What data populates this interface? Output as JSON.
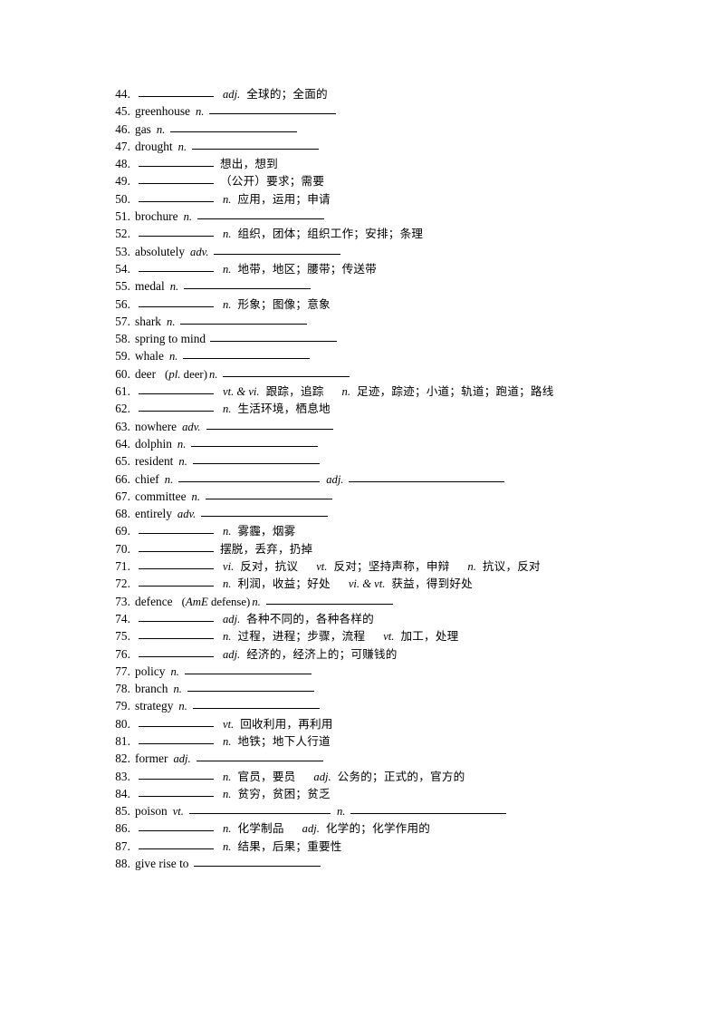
{
  "document": {
    "type": "vocabulary-worksheet",
    "first_number": 44,
    "last_number": 88
  },
  "entries": [
    {
      "num": "44.",
      "word": "",
      "blank_word": true,
      "parts": [
        {
          "pos": "adj.",
          "gloss": "全球的；全面的"
        }
      ]
    },
    {
      "num": "45.",
      "word": "greenhouse",
      "blank_word": false,
      "parts": [
        {
          "pos": "n.",
          "gloss": "",
          "blank": "def-slot"
        }
      ]
    },
    {
      "num": "46.",
      "word": "gas",
      "blank_word": false,
      "parts": [
        {
          "pos": "n.",
          "gloss": "",
          "blank": "def-slot"
        }
      ]
    },
    {
      "num": "47.",
      "word": "drought",
      "blank_word": false,
      "parts": [
        {
          "pos": "n.",
          "gloss": "",
          "blank": "def-slot"
        }
      ]
    },
    {
      "num": "48.",
      "word": "",
      "blank_word": true,
      "parts": [
        {
          "pos": "",
          "gloss": "想出，想到"
        }
      ]
    },
    {
      "num": "49.",
      "word": "",
      "blank_word": true,
      "parts": [
        {
          "pos": "",
          "gloss": "（公开）要求；需要"
        }
      ]
    },
    {
      "num": "50.",
      "word": "",
      "blank_word": true,
      "parts": [
        {
          "pos": "n.",
          "gloss": "应用，运用；申请"
        }
      ]
    },
    {
      "num": "51.",
      "word": "brochure",
      "blank_word": false,
      "parts": [
        {
          "pos": "n.",
          "gloss": "",
          "blank": "def-slot"
        }
      ]
    },
    {
      "num": "52.",
      "word": "",
      "blank_word": true,
      "parts": [
        {
          "pos": "n.",
          "gloss": "组织，团体；组织工作；安排；条理"
        }
      ]
    },
    {
      "num": "53.",
      "word": "absolutely",
      "blank_word": false,
      "parts": [
        {
          "pos": "adv.",
          "gloss": "",
          "blank": "def-slot"
        }
      ]
    },
    {
      "num": "54.",
      "word": "",
      "blank_word": true,
      "parts": [
        {
          "pos": "n.",
          "gloss": "地带，地区；腰带；传送带"
        }
      ]
    },
    {
      "num": "55.",
      "word": "medal",
      "blank_word": false,
      "parts": [
        {
          "pos": "n.",
          "gloss": "",
          "blank": "def-slot"
        }
      ]
    },
    {
      "num": "56.",
      "word": "",
      "blank_word": true,
      "parts": [
        {
          "pos": "n.",
          "gloss": "形象；图像；意象"
        }
      ]
    },
    {
      "num": "57.",
      "word": "shark",
      "blank_word": false,
      "parts": [
        {
          "pos": "n.",
          "gloss": "",
          "blank": "def-slot"
        }
      ]
    },
    {
      "num": "58.",
      "word": "spring to mind",
      "blank_word": false,
      "parts": [
        {
          "pos": "",
          "gloss": "",
          "blank": "def-slot"
        }
      ]
    },
    {
      "num": "59.",
      "word": "whale",
      "blank_word": false,
      "parts": [
        {
          "pos": "n.",
          "gloss": "",
          "blank": "def-slot"
        }
      ]
    },
    {
      "num": "60.",
      "word": "deer",
      "blank_word": false,
      "note": "(pl. deer)",
      "note_italic": "pl.",
      "note_rest": " deer)",
      "note_open": "(",
      "parts": [
        {
          "pos": "n.",
          "gloss": "",
          "blank": "def-slot",
          "after_note": true
        }
      ]
    },
    {
      "num": "61.",
      "word": "",
      "blank_word": true,
      "parts": [
        {
          "pos": "vt. & vi.",
          "gloss": "跟踪，追踪"
        },
        {
          "pos": "n.",
          "gloss": "足迹，踪迹；小道；轨道；跑道；路线"
        }
      ]
    },
    {
      "num": "62.",
      "word": "",
      "blank_word": true,
      "parts": [
        {
          "pos": "n.",
          "gloss": "生活环境，栖息地"
        }
      ]
    },
    {
      "num": "63.",
      "word": "nowhere",
      "blank_word": false,
      "parts": [
        {
          "pos": "adv.",
          "gloss": "",
          "blank": "def-slot"
        }
      ]
    },
    {
      "num": "64.",
      "word": "dolphin",
      "blank_word": false,
      "parts": [
        {
          "pos": "n.",
          "gloss": "",
          "blank": "def-slot"
        }
      ]
    },
    {
      "num": "65.",
      "word": "resident",
      "blank_word": false,
      "parts": [
        {
          "pos": "n.",
          "gloss": "",
          "blank": "def-slot"
        }
      ]
    },
    {
      "num": "66.",
      "word": "chief",
      "blank_word": false,
      "parts": [
        {
          "pos": "n.",
          "gloss": "",
          "blank": "def-wide"
        },
        {
          "pos": "adj.",
          "gloss": "",
          "blank": "def-xwide"
        }
      ]
    },
    {
      "num": "67.",
      "word": "committee",
      "blank_word": false,
      "parts": [
        {
          "pos": "n.",
          "gloss": "",
          "blank": "def-slot"
        }
      ]
    },
    {
      "num": "68.",
      "word": "entirely",
      "blank_word": false,
      "parts": [
        {
          "pos": "adv.",
          "gloss": "",
          "blank": "def-slot"
        }
      ]
    },
    {
      "num": "69.",
      "word": "",
      "blank_word": true,
      "parts": [
        {
          "pos": "n.",
          "gloss": "雾霾，烟雾"
        }
      ]
    },
    {
      "num": "70.",
      "word": "",
      "blank_word": true,
      "parts": [
        {
          "pos": "",
          "gloss": "摆脱，丢弃，扔掉"
        }
      ]
    },
    {
      "num": "71.",
      "word": "",
      "blank_word": true,
      "parts": [
        {
          "pos": "vi.",
          "gloss": "反对，抗议"
        },
        {
          "pos": "vt.",
          "gloss": "反对；坚持声称，申辩"
        },
        {
          "pos": "n.",
          "gloss": "抗议，反对"
        }
      ]
    },
    {
      "num": "72.",
      "word": "",
      "blank_word": true,
      "parts": [
        {
          "pos": "n.",
          "gloss": "利润，收益；好处"
        },
        {
          "pos": "vi. & vt.",
          "gloss": "获益，得到好处"
        }
      ]
    },
    {
      "num": "73.",
      "word": "defence",
      "blank_word": false,
      "note_open": "(",
      "note_italic": "AmE",
      "note_rest": " defense)",
      "parts": [
        {
          "pos": "n.",
          "gloss": "",
          "blank": "def-slot",
          "after_note": true
        }
      ]
    },
    {
      "num": "74.",
      "word": "",
      "blank_word": true,
      "parts": [
        {
          "pos": "adj.",
          "gloss": "各种不同的，各种各样的"
        }
      ]
    },
    {
      "num": "75.",
      "word": "",
      "blank_word": true,
      "parts": [
        {
          "pos": "n.",
          "gloss": "过程，进程；步骤，流程"
        },
        {
          "pos": "vt.",
          "gloss": "加工，处理"
        }
      ]
    },
    {
      "num": "76.",
      "word": "",
      "blank_word": true,
      "parts": [
        {
          "pos": "adj.",
          "gloss": "经济的，经济上的；可赚钱的"
        }
      ]
    },
    {
      "num": "77.",
      "word": "policy",
      "blank_word": false,
      "parts": [
        {
          "pos": "n.",
          "gloss": "",
          "blank": "def-slot"
        }
      ]
    },
    {
      "num": "78.",
      "word": "branch",
      "blank_word": false,
      "parts": [
        {
          "pos": "n.",
          "gloss": "",
          "blank": "def-slot"
        }
      ]
    },
    {
      "num": "79.",
      "word": "strategy",
      "blank_word": false,
      "parts": [
        {
          "pos": "n.",
          "gloss": "",
          "blank": "def-slot"
        }
      ]
    },
    {
      "num": "80.",
      "word": "",
      "blank_word": true,
      "parts": [
        {
          "pos": "vt.",
          "gloss": "回收利用，再利用"
        }
      ]
    },
    {
      "num": "81.",
      "word": "",
      "blank_word": true,
      "parts": [
        {
          "pos": "n.",
          "gloss": "地铁；地下人行道"
        }
      ]
    },
    {
      "num": "82.",
      "word": "former",
      "blank_word": false,
      "parts": [
        {
          "pos": "adj.",
          "gloss": "",
          "blank": "def-slot"
        }
      ]
    },
    {
      "num": "83.",
      "word": "",
      "blank_word": true,
      "parts": [
        {
          "pos": "n.",
          "gloss": "官员，要员"
        },
        {
          "pos": "adj.",
          "gloss": "公务的；正式的，官方的"
        }
      ]
    },
    {
      "num": "84.",
      "word": "",
      "blank_word": true,
      "parts": [
        {
          "pos": "n.",
          "gloss": "贫穷，贫困；贫乏"
        }
      ]
    },
    {
      "num": "85.",
      "word": "poison",
      "blank_word": false,
      "parts": [
        {
          "pos": "vt.",
          "gloss": "",
          "blank": "def-wide"
        },
        {
          "pos": "n.",
          "gloss": "",
          "blank": "def-xwide"
        }
      ]
    },
    {
      "num": "86.",
      "word": "",
      "blank_word": true,
      "parts": [
        {
          "pos": "n.",
          "gloss": "化学制品"
        },
        {
          "pos": "adj.",
          "gloss": "化学的；化学作用的"
        }
      ]
    },
    {
      "num": "87.",
      "word": "",
      "blank_word": true,
      "parts": [
        {
          "pos": "n.",
          "gloss": "结果，后果；重要性"
        }
      ]
    },
    {
      "num": "88.",
      "word": "give rise to",
      "blank_word": false,
      "parts": [
        {
          "pos": "",
          "gloss": "",
          "blank": "def-slot"
        }
      ]
    }
  ]
}
